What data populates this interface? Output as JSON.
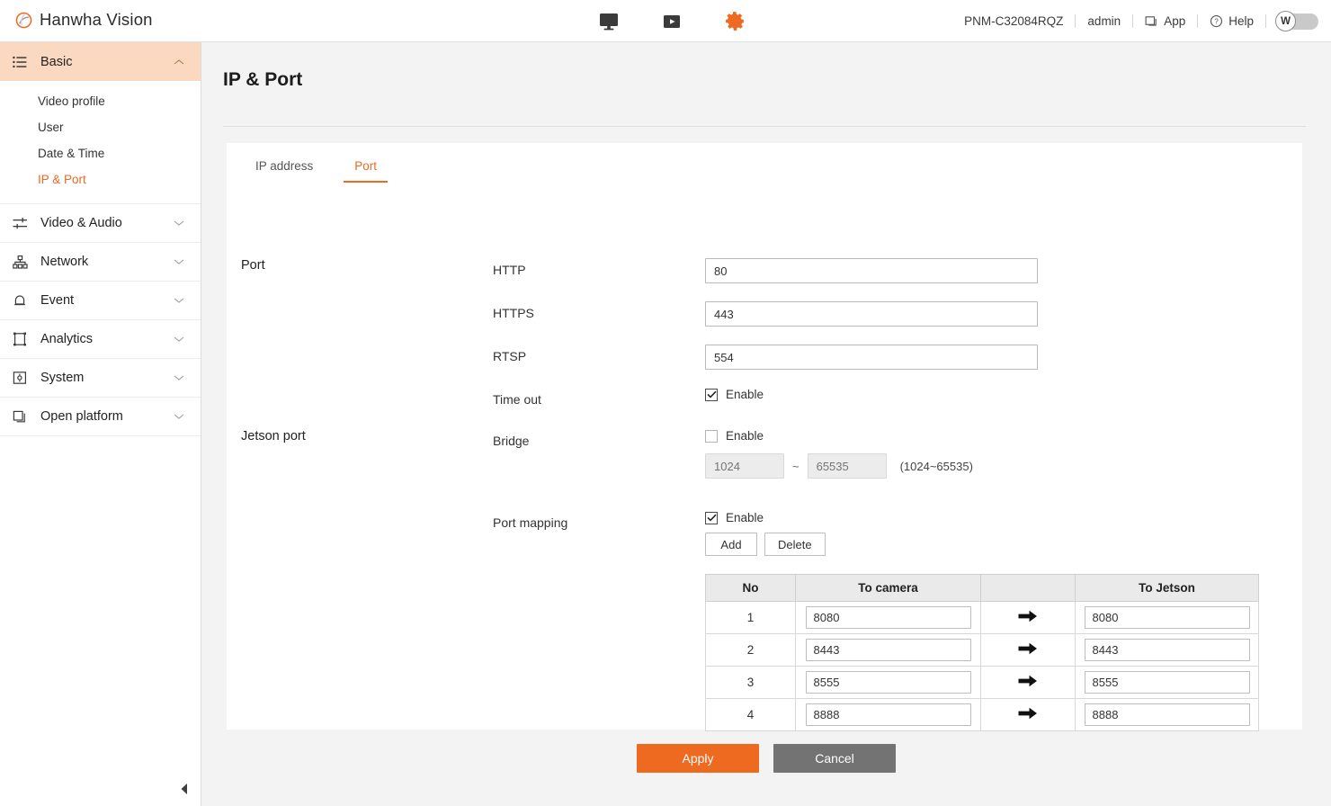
{
  "header": {
    "brand": "Hanwha Vision",
    "nav_icons": [
      {
        "name": "monitor-icon",
        "label": "Live"
      },
      {
        "name": "play-icon",
        "label": "Playback"
      },
      {
        "name": "gear-icon",
        "label": "Setup"
      }
    ],
    "model": "PNM-C32084RQZ",
    "user": "admin",
    "app_label": "App",
    "help_label": "Help",
    "avatar_initial": "W"
  },
  "sidebar": {
    "groups": [
      {
        "label": "Basic",
        "icon": "list-icon",
        "active": true,
        "expanded": true,
        "items": [
          {
            "label": "Video profile",
            "active": false
          },
          {
            "label": "User",
            "active": false
          },
          {
            "label": "Date & Time",
            "active": false
          },
          {
            "label": "IP & Port",
            "active": true
          }
        ]
      },
      {
        "label": "Video & Audio",
        "icon": "sliders-icon",
        "active": false,
        "expanded": false,
        "items": []
      },
      {
        "label": "Network",
        "icon": "network-icon",
        "active": false,
        "expanded": false,
        "items": []
      },
      {
        "label": "Event",
        "icon": "bell-icon",
        "active": false,
        "expanded": false,
        "items": []
      },
      {
        "label": "Analytics",
        "icon": "frame-icon",
        "active": false,
        "expanded": false,
        "items": []
      },
      {
        "label": "System",
        "icon": "system-icon",
        "active": false,
        "expanded": false,
        "items": []
      },
      {
        "label": "Open platform",
        "icon": "layers-icon",
        "active": false,
        "expanded": false,
        "items": []
      }
    ]
  },
  "page": {
    "title": "IP & Port",
    "tabs": [
      {
        "label": "IP address",
        "active": false
      },
      {
        "label": "Port",
        "active": true
      }
    ]
  },
  "port_section": {
    "title": "Port",
    "http": {
      "label": "HTTP",
      "value": "80"
    },
    "https": {
      "label": "HTTPS",
      "value": "443"
    },
    "rtsp": {
      "label": "RTSP",
      "value": "554"
    },
    "timeout": {
      "label": "Time out",
      "enable_label": "Enable",
      "checked": true
    }
  },
  "jetson_section": {
    "title": "Jetson port",
    "bridge": {
      "label": "Bridge",
      "enable_label": "Enable",
      "checked": false,
      "from_placeholder": "1024",
      "to_placeholder": "65535",
      "dash": "~",
      "hint": "(1024~65535)"
    },
    "port_mapping": {
      "label": "Port mapping",
      "enable_label": "Enable",
      "checked": true,
      "add_label": "Add",
      "delete_label": "Delete",
      "columns": [
        "No",
        "To camera",
        "",
        "To Jetson"
      ],
      "rows": [
        {
          "no": "1",
          "to_camera": "8080",
          "to_jetson": "8080"
        },
        {
          "no": "2",
          "to_camera": "8443",
          "to_jetson": "8443"
        },
        {
          "no": "3",
          "to_camera": "8555",
          "to_jetson": "8555"
        },
        {
          "no": "4",
          "to_camera": "8888",
          "to_jetson": "8888"
        }
      ]
    }
  },
  "footer": {
    "apply_label": "Apply",
    "cancel_label": "Cancel"
  },
  "colors": {
    "accent": "#ee6a21",
    "active_nav_bg": "#fbd9c1",
    "cancel": "#737373",
    "page_bg": "#f3f3f3"
  }
}
